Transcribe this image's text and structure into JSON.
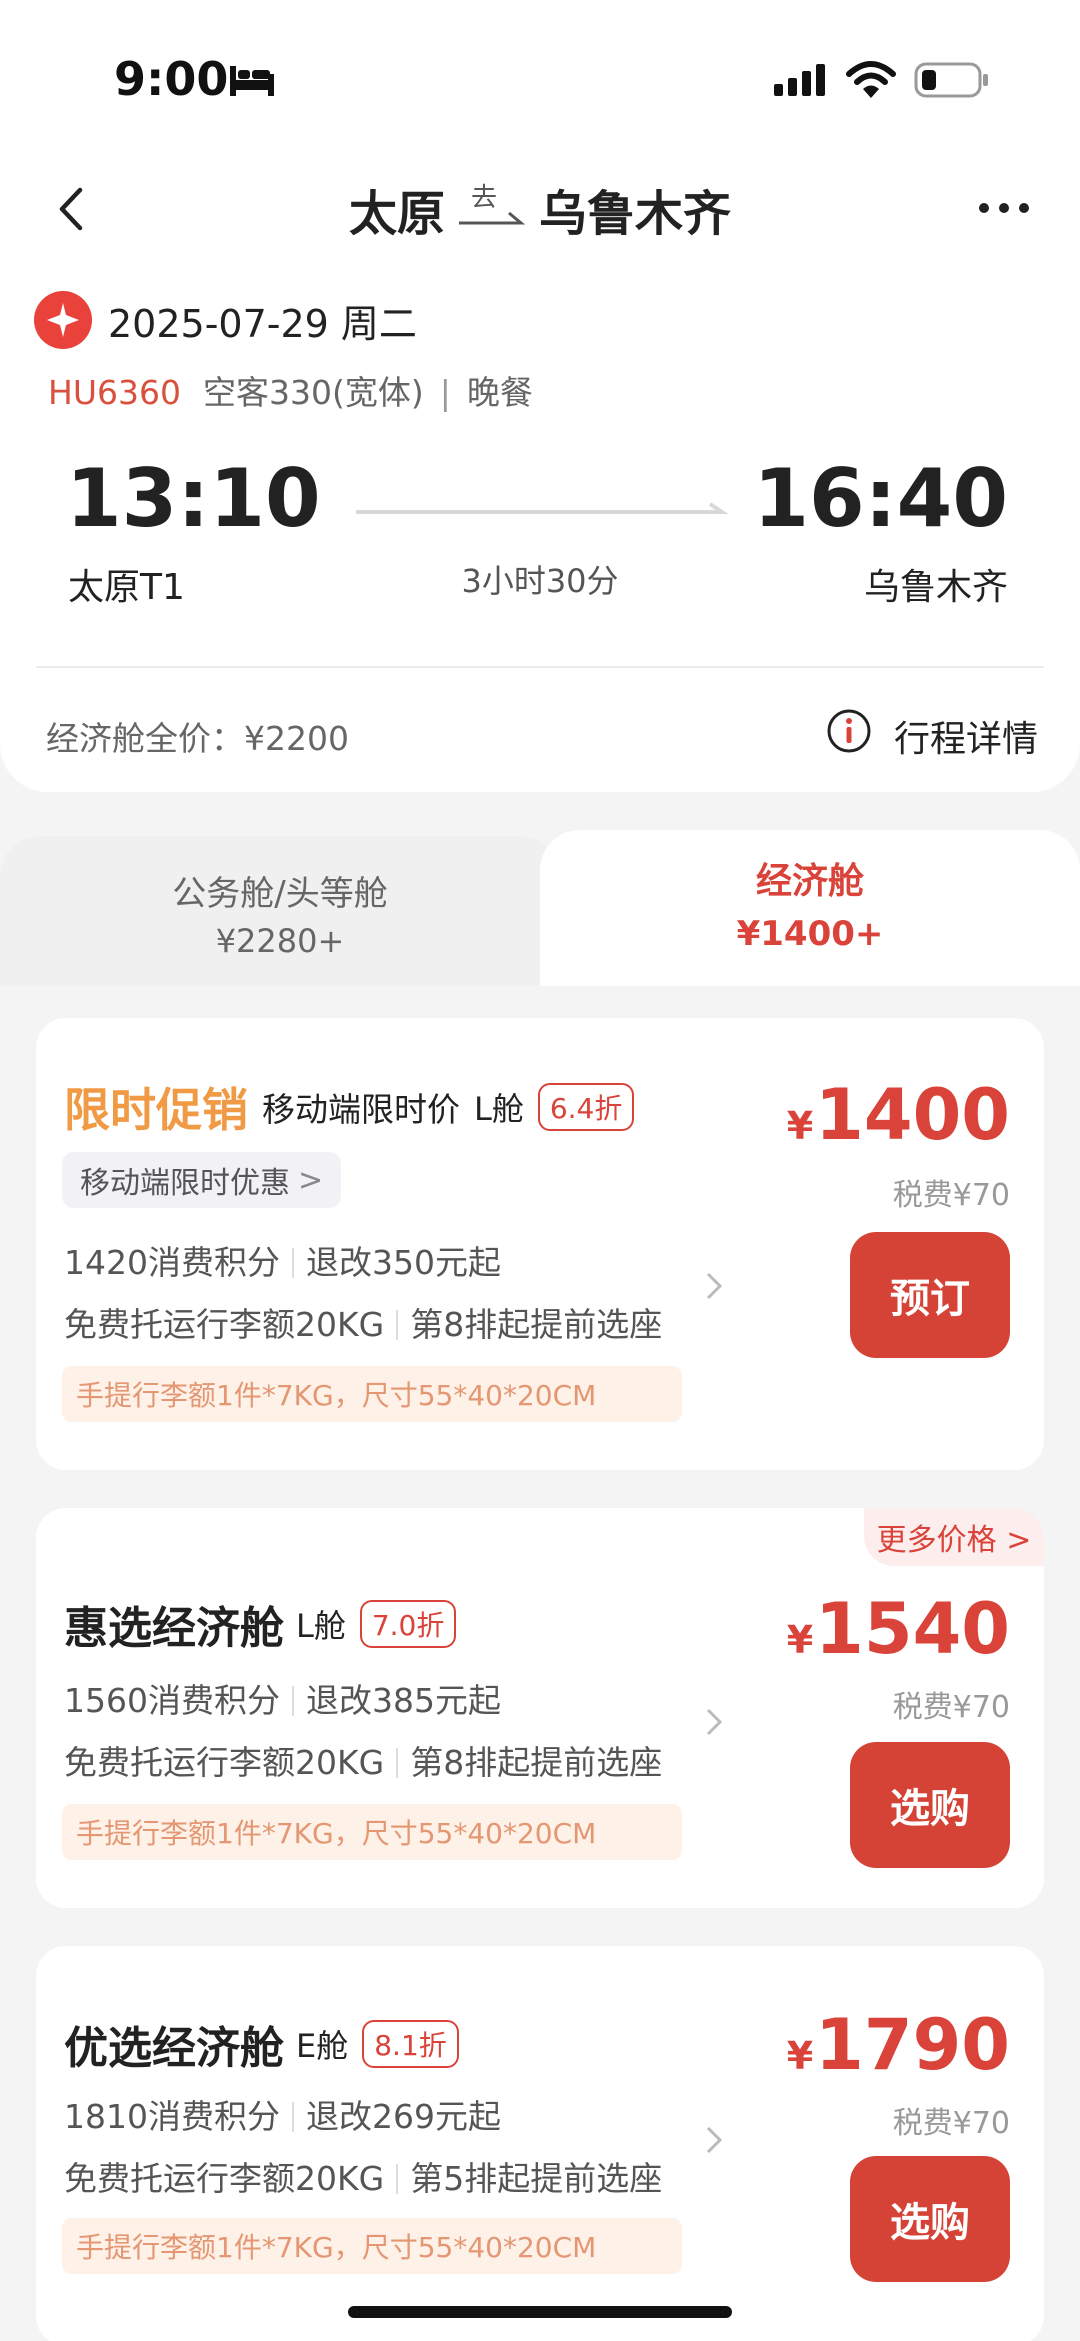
{
  "status_bar": {
    "time": "9:00"
  },
  "nav": {
    "from": "太原",
    "to": "乌鲁木齐",
    "direction_label": "去"
  },
  "flight": {
    "date": "2025-07-29 周二",
    "flight_no": "HU6360",
    "aircraft": "空客330(宽体)",
    "separator": "|",
    "meal": "晚餐",
    "dep_time": "13:10",
    "dep_airport": "太原T1",
    "arr_time": "16:40",
    "arr_airport": "乌鲁木齐",
    "duration": "3小时30分",
    "full_price": "经济舱全价：¥2200",
    "detail_link": "行程详情"
  },
  "tabs": [
    {
      "name": "公务舱/头等舱",
      "price": "¥2280+",
      "active": false
    },
    {
      "name": "经济舱",
      "price": "¥1400+",
      "active": true
    }
  ],
  "fares": [
    {
      "promo": "限时促销",
      "subtitle": "移动端限时价",
      "cabin": "L舱",
      "discount": "6.4折",
      "chip": "移动端限时优惠",
      "chip_chevron": ">",
      "points": "1420消费积分",
      "refund": "退改350元起",
      "baggage_free": "免费托运行李额20KG",
      "seat": "第8排起提前选座",
      "carry_on": "手提行李额1件*7KG，尺寸55*40*20CM",
      "currency": "¥",
      "price": "1400",
      "tax": "税费¥70",
      "button": "预订"
    },
    {
      "name": "惠选经济舱",
      "cabin": "L舱",
      "discount": "7.0折",
      "more": "更多价格 >",
      "points": "1560消费积分",
      "refund": "退改385元起",
      "baggage_free": "免费托运行李额20KG",
      "seat": "第8排起提前选座",
      "carry_on": "手提行李额1件*7KG，尺寸55*40*20CM",
      "currency": "¥",
      "price": "1540",
      "tax": "税费¥70",
      "button": "选购"
    },
    {
      "name": "优选经济舱",
      "cabin": "E舱",
      "discount": "8.1折",
      "points": "1810消费积分",
      "refund": "退改269元起",
      "baggage_free": "免费托运行李额20KG",
      "seat": "第5排起提前选座",
      "carry_on": "手提行李额1件*7KG，尺寸55*40*20CM",
      "currency": "¥",
      "price": "1790",
      "tax": "税费¥70",
      "button": "选购"
    }
  ],
  "colors": {
    "accent": "#d9433a",
    "promo": "#f09a45",
    "button": "#d44336",
    "baggage_bg": "#fdf1e8"
  }
}
